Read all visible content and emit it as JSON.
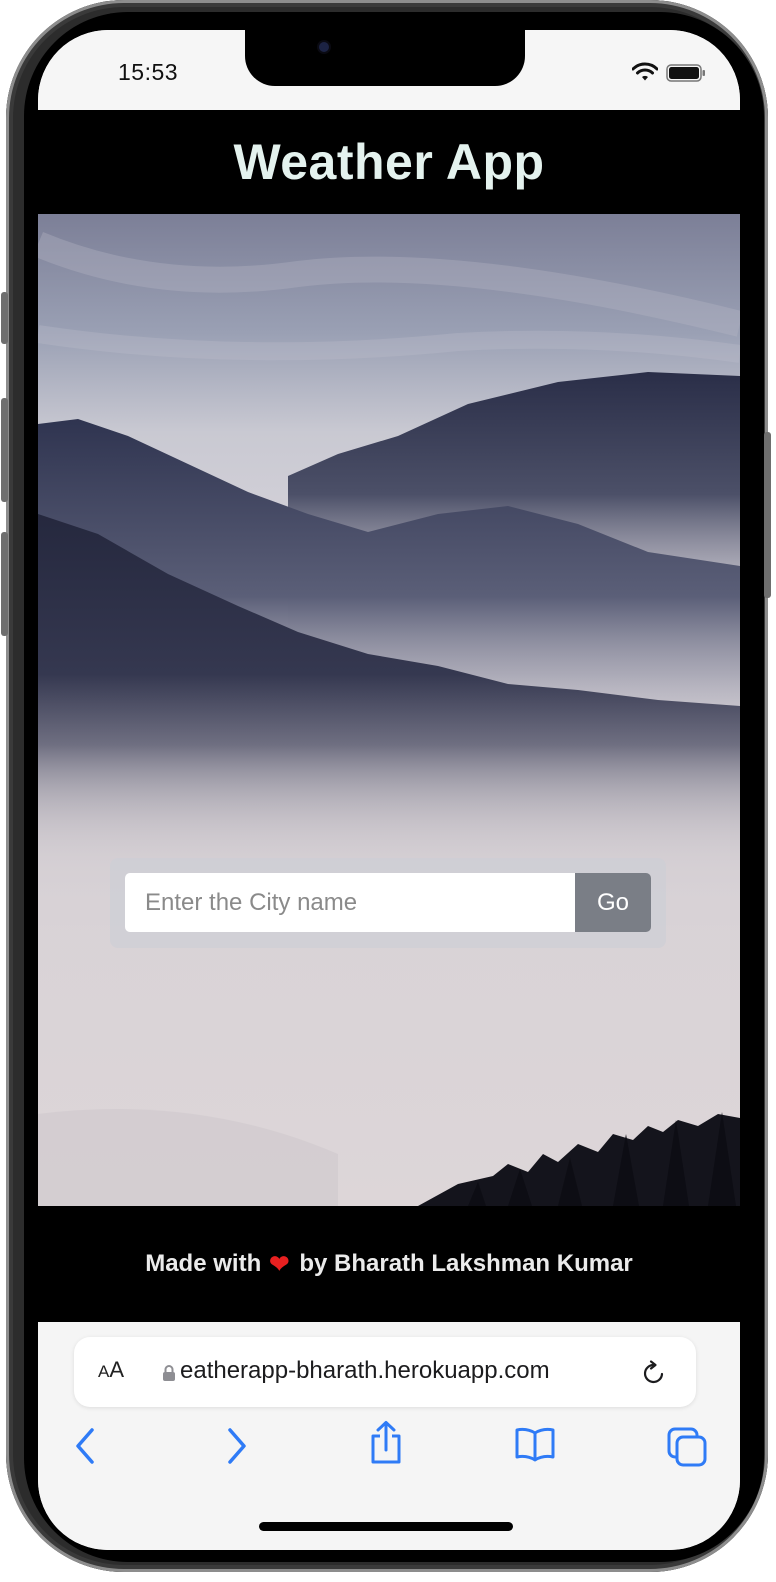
{
  "status_bar": {
    "time": "15:53"
  },
  "header": {
    "title": "Weather App"
  },
  "search": {
    "placeholder": "Enter the City name",
    "value": "",
    "go_label": "Go"
  },
  "footer": {
    "text_before": "Made with",
    "text_after": "by Bharath Lakshman Kumar",
    "heart_icon": "red-heart-emoji"
  },
  "browser": {
    "aa_label_small": "A",
    "aa_label_large": "A",
    "url": "eatherapp-bharath.herokuapp.com",
    "toolbar_icons": [
      "back-chevron-icon",
      "forward-chevron-icon",
      "share-icon",
      "bookmarks-icon",
      "tabs-icon"
    ],
    "accent_color": "#2f7bf6"
  },
  "colors": {
    "header_bg": "#000000",
    "title_color": "#e4f2ee",
    "go_button_bg": "#7a7e86"
  }
}
